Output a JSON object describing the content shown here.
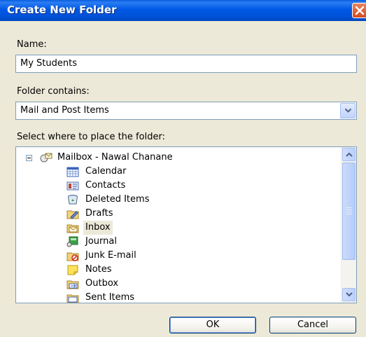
{
  "window": {
    "title": "Create New Folder"
  },
  "name_field": {
    "label": "Name:",
    "value": "My Students"
  },
  "contains_field": {
    "label": "Folder contains:",
    "value": "Mail and Post Items"
  },
  "tree_label": "Select where to place the folder:",
  "tree": {
    "root": {
      "label": "Mailbox - Nawal Chanane",
      "icon": "mailbox-icon",
      "expanded": true
    },
    "items": [
      {
        "label": "Calendar",
        "icon": "calendar-icon"
      },
      {
        "label": "Contacts",
        "icon": "contacts-icon"
      },
      {
        "label": "Deleted Items",
        "icon": "deleted-items-icon"
      },
      {
        "label": "Drafts",
        "icon": "drafts-icon"
      },
      {
        "label": "Inbox",
        "icon": "inbox-icon",
        "selected": true
      },
      {
        "label": "Journal",
        "icon": "journal-icon"
      },
      {
        "label": "Junk E-mail",
        "icon": "junk-email-icon"
      },
      {
        "label": "Notes",
        "icon": "notes-icon"
      },
      {
        "label": "Outbox",
        "icon": "outbox-icon"
      },
      {
        "label": "Sent Items",
        "icon": "sent-items-icon"
      }
    ]
  },
  "buttons": {
    "ok": "OK",
    "cancel": "Cancel"
  },
  "colors": {
    "titlebar": "#0058e6",
    "dialog_bg": "#ece9d8",
    "border": "#7f9db9",
    "selection": "#ece9d8"
  }
}
